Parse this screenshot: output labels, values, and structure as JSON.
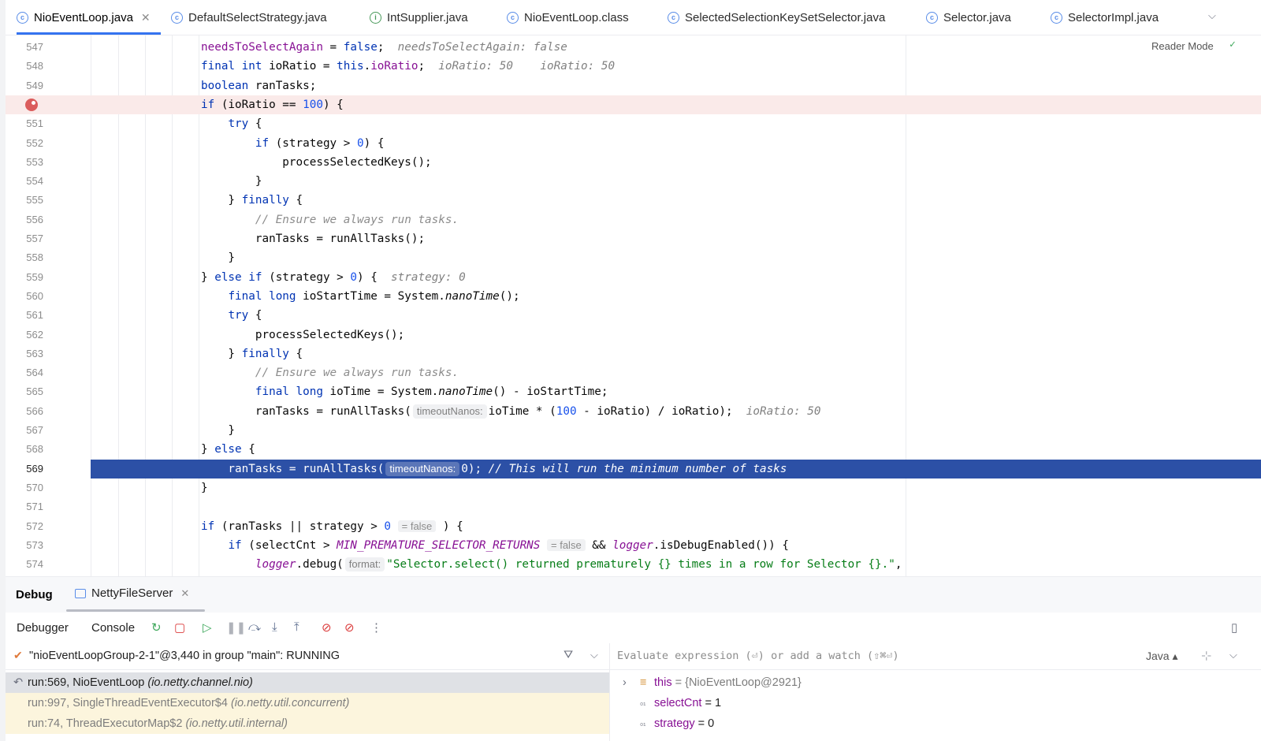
{
  "tabs": [
    {
      "label": "NioEventLoop.java",
      "active": true,
      "icon": "class-icon",
      "closable": true
    },
    {
      "label": "DefaultSelectStrategy.java",
      "icon": "class-icon"
    },
    {
      "label": "IntSupplier.java",
      "icon": "interface-icon"
    },
    {
      "label": "NioEventLoop.class",
      "icon": "class-icon"
    },
    {
      "label": "SelectedSelectionKeySetSelector.java",
      "icon": "class-icon"
    },
    {
      "label": "Selector.java",
      "icon": "class-icon"
    },
    {
      "label": "SelectorImpl.java",
      "icon": "class-icon"
    }
  ],
  "editor": {
    "reader_mode": "Reader Mode",
    "line_numbers": [
      "547",
      "548",
      "549",
      "550",
      "551",
      "552",
      "553",
      "554",
      "555",
      "556",
      "557",
      "558",
      "559",
      "560",
      "561",
      "562",
      "563",
      "564",
      "565",
      "566",
      "567",
      "568",
      "569",
      "570",
      "571",
      "572",
      "573",
      "574"
    ],
    "breakpoint_line": "550",
    "current_line": "569"
  },
  "debug": {
    "title": "Debug",
    "session": "NettyFileServer",
    "tabs": {
      "debugger": "Debugger",
      "console": "Console"
    },
    "thread": "\"nioEventLoopGroup-2-1\"@3,440 in group \"main\": RUNNING",
    "frames": [
      {
        "method": "run:569, NioEventLoop",
        "pkg": "(io.netty.channel.nio)",
        "current": true
      },
      {
        "method": "run:997, SingleThreadEventExecutor$4",
        "pkg": "(io.netty.util.concurrent)"
      },
      {
        "method": "run:74, ThreadExecutorMap$2",
        "pkg": "(io.netty.util.internal)"
      }
    ],
    "eval_placeholder": "Evaluate expression (⏎) or add a watch (⇧⌘⏎)",
    "language": "Java",
    "variables": [
      {
        "name": "this",
        "value": " = {NioEventLoop@2921}",
        "expandable": true
      },
      {
        "name": "selectCnt",
        "value": " = 1"
      },
      {
        "name": "strategy",
        "value": " = 0"
      }
    ]
  },
  "colors": {
    "accent": "#3574f0",
    "exec_line": "#2c50a6",
    "breakpoint": "#db5c5c"
  }
}
